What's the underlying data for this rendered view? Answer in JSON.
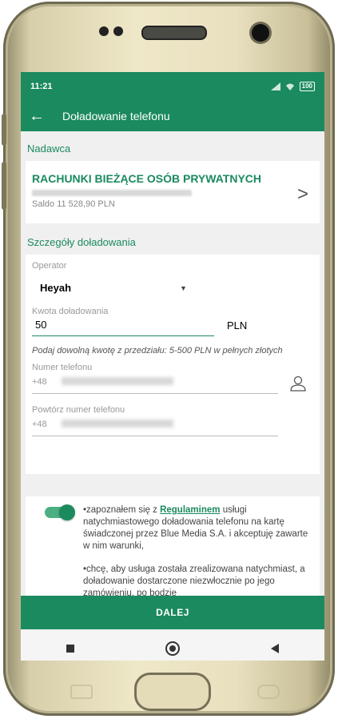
{
  "status": {
    "time": "11:21",
    "battery": "100"
  },
  "appbar": {
    "title": "Doładowanie telefonu"
  },
  "sender": {
    "section_title": "Nadawca",
    "account_name": "RACHUNKI BIEŻĄCE OSÓB PRYWATNYCH",
    "saldo": "Saldo  11 528,90 PLN"
  },
  "details": {
    "section_title": "Szczegóły doładowania",
    "operator_label": "Operator",
    "operator_value": "Heyah",
    "amount_label": "Kwota doładowania",
    "amount_value": "50",
    "currency": "PLN",
    "amount_hint": "Podaj dowolną kwotę z przedziału: 5-500 PLN w pełnych złotych",
    "phone_label": "Numer telefonu",
    "phone_prefix": "+48",
    "phone_repeat_label": "Powtórz numer telefonu",
    "phone_repeat_prefix": "+48"
  },
  "consent": {
    "toggle_on": true,
    "text1_pre": "•zapoznałem się z ",
    "text1_link": "Regulaminem",
    "text1_post": " usługi natychmiastowego doładowania telefonu na kartę świadczonej przez Blue Media S.A. i akceptuję zawarte w nim warunki,",
    "text2": "•chcę, aby usługa została zrealizowana natychmiast, a doładowanie dostarczone niezwłocznie po jego zamówieniu, po bodzie"
  },
  "actions": {
    "next": "DALEJ"
  },
  "icons": {
    "back": "arrow-left-icon",
    "chevron": "chevron-right-icon",
    "contact": "person-icon"
  },
  "colors": {
    "accent": "#1b8a5e"
  }
}
